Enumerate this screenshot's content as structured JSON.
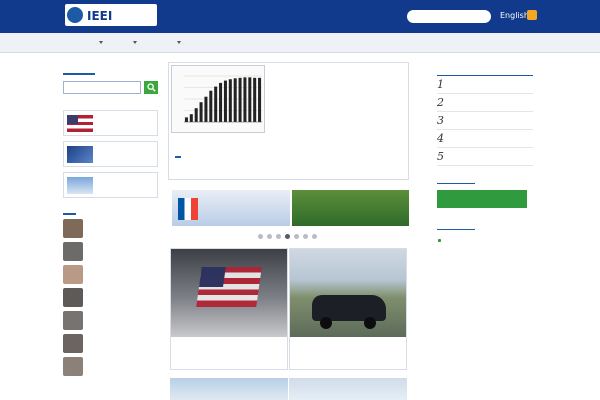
{
  "colors": {
    "header_bg": "#123a8c",
    "accent": "#1e5aa8",
    "green": "#2f9a3e",
    "nav_bg": "#eef1f5"
  },
  "header": {
    "logo_text": "IEEI",
    "tagline": "",
    "search_label": "",
    "lang_label": "English",
    "rss_icon": "rss-icon"
  },
  "nav": {
    "items": [
      {
        "label": ""
      },
      {
        "label": ""
      },
      {
        "label": ""
      },
      {
        "label": ""
      },
      {
        "label": ""
      },
      {
        "label": ""
      }
    ]
  },
  "sidebar": {
    "search_heading": "",
    "search_placeholder": "",
    "banners": [
      {
        "label": ""
      },
      {
        "label": ""
      },
      {
        "label": ""
      }
    ],
    "authors_heading": "",
    "authors": [
      {
        "name": ""
      },
      {
        "name": ""
      },
      {
        "name": ""
      },
      {
        "name": ""
      },
      {
        "name": ""
      },
      {
        "name": ""
      },
      {
        "name": ""
      }
    ]
  },
  "feature": {
    "title": "",
    "subtitle": "",
    "meta": "",
    "body": "",
    "more": "",
    "footer": ""
  },
  "carousel": {
    "slides": [
      {
        "caption": "",
        "caption_sub": ""
      },
      {
        "caption": "",
        "caption_sub": ""
      }
    ],
    "dot_count": 7,
    "active_dot": 3
  },
  "articles": [
    {
      "title": "",
      "subtitle": "",
      "byline": ""
    },
    {
      "title": "",
      "subtitle": "",
      "byline": ""
    }
  ],
  "ranking": {
    "heading": "",
    "items": [
      {
        "num": "1",
        "text": ""
      },
      {
        "num": "2",
        "text": ""
      },
      {
        "num": "3",
        "text": ""
      },
      {
        "num": "4",
        "text": ""
      },
      {
        "num": "5",
        "text": ""
      }
    ]
  },
  "news": {
    "heading": "",
    "items": [
      {
        "text": "",
        "date": "",
        "new": ""
      },
      {
        "text": "",
        "date": "",
        "new": ""
      },
      {
        "text": "",
        "date": "",
        "new": ""
      },
      {
        "text": "",
        "date": "",
        "new": ""
      },
      {
        "text": "",
        "date": "",
        "new": ""
      }
    ],
    "button_label": ""
  },
  "reports": {
    "heading": "",
    "items": [
      {
        "text": "",
        "date": ""
      },
      {
        "text": "",
        "date": ""
      },
      {
        "text": "",
        "date": ""
      }
    ]
  },
  "feature_chart": {
    "type": "bar",
    "values": [
      1.0,
      1.7,
      3.0,
      4.3,
      5.5,
      6.8,
      7.7,
      8.5,
      9.0,
      9.3,
      9.5,
      9.6,
      9.7,
      9.7,
      9.6,
      9.6
    ],
    "ylim": [
      0,
      10
    ],
    "caption": ""
  }
}
